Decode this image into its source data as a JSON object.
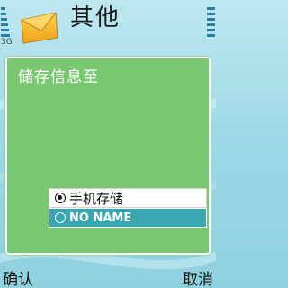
{
  "header": {
    "title": "其他",
    "app_icon": "envelope-icon",
    "signal_label": "3G",
    "battery_label": ""
  },
  "dialog": {
    "heading": "储存信息至",
    "options": [
      {
        "label": "手机存储",
        "selected": true
      },
      {
        "label": "NO NAME",
        "selected": false
      }
    ]
  },
  "softkeys": {
    "left": "确认",
    "right": "取消"
  },
  "colors": {
    "dialog_bg": "#79c771",
    "focus_bg": "#3aa6b0",
    "page_bg": "#9fd9e6"
  }
}
